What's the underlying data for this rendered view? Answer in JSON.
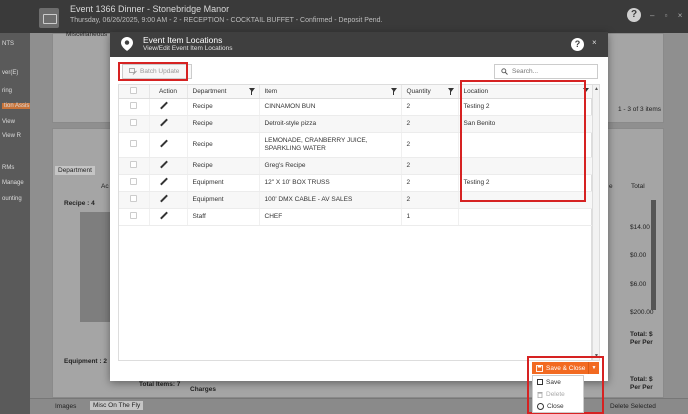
{
  "app": {
    "title": "Event 1366 Dinner - Stonebridge Manor",
    "subtitle": "Thursday, 06/26/2025, 9:00 AM - 2 - RECEPTION - COCKTAIL BUFFET - Confirmed - Deposit Pend.",
    "help_label": "?",
    "window_controls": "– ▫ ×",
    "sidebar_items": [
      "NTS",
      "ver(E)",
      "ring",
      "tion Assis",
      "View",
      "View R",
      "RMs",
      "Manage",
      "ounting"
    ],
    "bg_misc": "Miscellaneous",
    "bg_items_count": "1 - 3 of 3 items",
    "bg_department_chip": "Department",
    "bg_ac": "Ac",
    "bg_group_recipe": "Recipe : 4",
    "bg_group_equipment": "Equipment : 2",
    "bg_col_e": "e",
    "bg_col_total": "Total",
    "bg_prices": [
      "$14.00",
      "$0.00",
      "$6.00",
      "$200.00"
    ],
    "bg_total_per": "Total: $\nPer Per",
    "bg_total_items": "Total Items: 7",
    "bg_charges": "Charges",
    "bg_images": "Images",
    "bg_misc_fly": "Misc On The Fly",
    "bg_delete_selected": "Delete Selected"
  },
  "modal": {
    "title": "Event Item Locations",
    "subtitle": "View/Edit Event Item Locations",
    "help_label": "?",
    "close_label": "×",
    "batch_update_label": "Batch Update",
    "search_placeholder": "Search...",
    "columns": {
      "action": "Action",
      "department": "Department",
      "item": "Item",
      "quantity": "Quantity",
      "location": "Location"
    },
    "rows": [
      {
        "department": "Recipe",
        "item": "CINNAMON BUN",
        "quantity": "2",
        "location": "Testing 2"
      },
      {
        "department": "Recipe",
        "item": "Detroit-style pizza",
        "quantity": "2",
        "location": "San Benito"
      },
      {
        "department": "Recipe",
        "item": "LEMONADE, CRANBERRY JUICE, SPARKLING WATER",
        "quantity": "2",
        "location": ""
      },
      {
        "department": "Recipe",
        "item": "Greg's Recipe",
        "quantity": "2",
        "location": ""
      },
      {
        "department": "Equipment",
        "item": "12\" X 10' BOX TRUSS",
        "quantity": "2",
        "location": "Testing 2"
      },
      {
        "department": "Equipment",
        "item": "100' DMX CABLE - AV SALES",
        "quantity": "2",
        "location": ""
      },
      {
        "department": "Staff",
        "item": "CHEF",
        "quantity": "1",
        "location": ""
      }
    ],
    "save_close_label": "Save & Close",
    "menu": {
      "save": "Save",
      "delete": "Delete",
      "close": "Close"
    }
  },
  "colors": {
    "accent": "#f26a21",
    "highlight": "#d62222",
    "header": "#3f3f3f"
  }
}
